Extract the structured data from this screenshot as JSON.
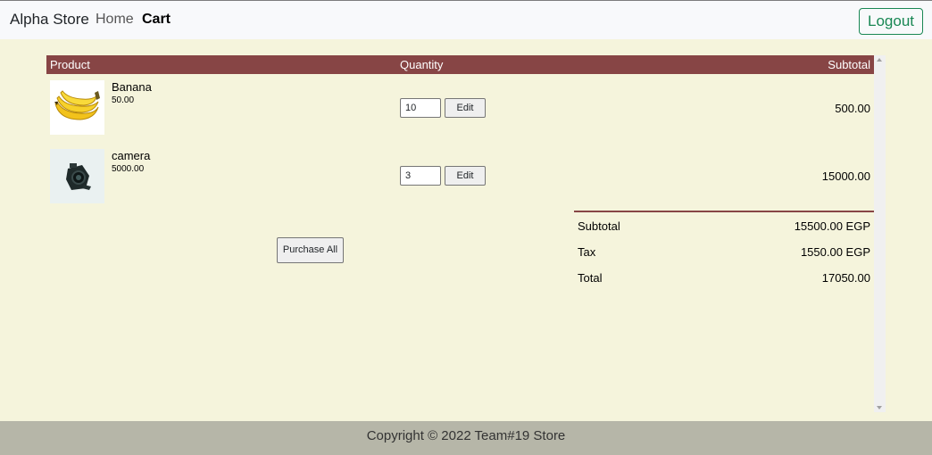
{
  "navbar": {
    "brand": "Alpha Store",
    "home": "Home",
    "cart": "Cart",
    "logout": "Logout"
  },
  "table": {
    "headers": {
      "product": "Product",
      "quantity": "Quantity",
      "subtotal": "Subtotal"
    },
    "rows": [
      {
        "name": "Banana",
        "price": "50.00",
        "quantity": "10",
        "edit": "Edit",
        "subtotal": "500.00",
        "image": "banana-image"
      },
      {
        "name": "camera",
        "price": "5000.00",
        "quantity": "3",
        "edit": "Edit",
        "subtotal": "15000.00",
        "image": "camera-image"
      }
    ]
  },
  "purchase_all": "Purchase All",
  "totals": {
    "subtotal_label": "Subtotal",
    "subtotal_value": "15500.00 EGP",
    "tax_label": "Tax",
    "tax_value": "1550.00 EGP",
    "total_label": "Total",
    "total_value": "17050.00"
  },
  "footer": "Copyright © 2022 Team#19 Store",
  "colors": {
    "accent": "#874545",
    "page_bg": "#f5f4dc",
    "footer_bg": "#b6b6a8",
    "logout_green": "#198754"
  }
}
